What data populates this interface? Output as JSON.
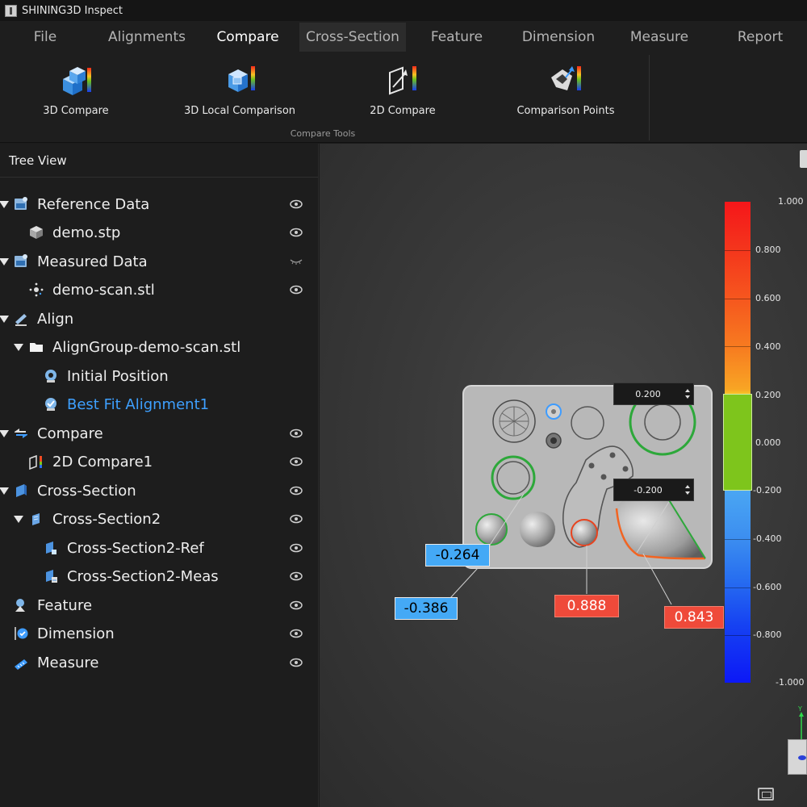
{
  "window": {
    "title": "SHINING3D Inspect"
  },
  "menu": {
    "tabs": [
      {
        "label": "File"
      },
      {
        "label": "Alignments"
      },
      {
        "label": "Compare"
      },
      {
        "label": "Cross-Section"
      },
      {
        "label": "Feature"
      },
      {
        "label": "Dimension"
      },
      {
        "label": "Measure"
      },
      {
        "label": "Report"
      }
    ],
    "active_tab": "Compare",
    "hovered_tab": "Cross-Section"
  },
  "ribbon": {
    "tools": [
      {
        "label": "3D Compare",
        "icon": "3d-compare-icon"
      },
      {
        "label": "3D Local Comparison",
        "icon": "3d-local-comparison-icon"
      },
      {
        "label": "2D Compare",
        "icon": "2d-compare-icon"
      },
      {
        "label": "Comparison Points",
        "icon": "comparison-points-icon"
      }
    ],
    "group_label": "Compare Tools"
  },
  "tree": {
    "header": "Tree View",
    "nodes": [
      {
        "label": "Reference Data",
        "icon": "reference-data-icon",
        "expanded": true,
        "visible": true
      },
      {
        "label": "demo.stp",
        "icon": "cad-part-icon",
        "visible": true
      },
      {
        "label": "Measured Data",
        "icon": "measured-data-icon",
        "expanded": true,
        "visible": false
      },
      {
        "label": "demo-scan.stl",
        "icon": "point-cloud-icon",
        "visible": true
      },
      {
        "label": "Align",
        "icon": "align-icon",
        "expanded": true
      },
      {
        "label": "AlignGroup-demo-scan.stl",
        "icon": "folder-icon",
        "expanded": true
      },
      {
        "label": "Initial Position",
        "icon": "initial-position-icon"
      },
      {
        "label": "Best Fit Alignment1",
        "icon": "best-fit-alignment-icon",
        "selected": true
      },
      {
        "label": "Compare",
        "icon": "compare-icon",
        "expanded": true,
        "visible": true
      },
      {
        "label": "2D Compare1",
        "icon": "2d-compare-icon",
        "visible": true
      },
      {
        "label": "Cross-Section",
        "icon": "cross-section-icon",
        "expanded": true,
        "visible": true
      },
      {
        "label": "Cross-Section2",
        "icon": "cross-section-plane-icon",
        "expanded": true,
        "visible": true
      },
      {
        "label": "Cross-Section2-Ref",
        "icon": "cross-section-ref-icon",
        "visible": true
      },
      {
        "label": "Cross-Section2-Meas",
        "icon": "cross-section-meas-icon",
        "visible": true
      },
      {
        "label": "Feature",
        "icon": "feature-icon",
        "visible": true
      },
      {
        "label": "Dimension",
        "icon": "dimension-icon",
        "visible": true
      },
      {
        "label": "Measure",
        "icon": "measure-icon",
        "visible": true
      }
    ]
  },
  "viewport": {
    "tolerance_upper": "0.200",
    "tolerance_lower": "-0.200",
    "callouts": [
      {
        "value": "-0.264",
        "color": "#44a9f6"
      },
      {
        "value": "-0.386",
        "color": "#44a9f6"
      },
      {
        "value": "0.888",
        "color": "#ef4a3a"
      },
      {
        "value": "0.843",
        "color": "#ef4a3a"
      }
    ],
    "colorbar": {
      "labels": [
        "1.000",
        "0.800",
        "0.600",
        "0.400",
        "0.200",
        "0.000",
        "-0.200",
        "-0.400",
        "-0.600",
        "-0.800",
        "-1.000"
      ]
    }
  }
}
